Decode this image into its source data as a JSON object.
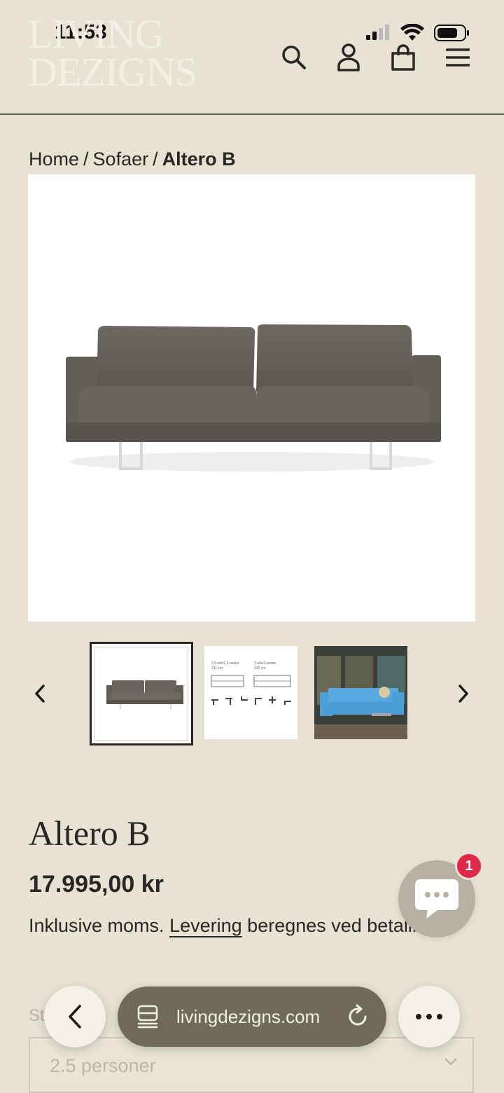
{
  "status_bar": {
    "time": "11:53"
  },
  "header": {
    "logo_line1": "LIVING",
    "logo_line2": "DEZIGNS",
    "icons": [
      "search-icon",
      "account-icon",
      "cart-icon",
      "menu-icon"
    ]
  },
  "breadcrumb": {
    "home": "Home",
    "sep": "/",
    "category": "Sofaer",
    "current": "Altero B"
  },
  "product": {
    "title": "Altero B",
    "price": "17.995,00 kr",
    "tax_prefix": "Inklusive moms.",
    "tax_link": "Levering",
    "tax_suffix": "beregnes ved betaling."
  },
  "thumbnails": {
    "spec_label_1": "2,5-sits/2,5-seater",
    "spec_size_1": "211 cm",
    "spec_label_2": "3-sits/3-seater",
    "spec_size_2": "242 cm"
  },
  "chat": {
    "badge": "1"
  },
  "size": {
    "label": "Størrelse",
    "value": "2.5 personer"
  },
  "browser": {
    "url": "livingdezigns.com"
  },
  "colors": {
    "background": "#e8e2d5",
    "text": "#2b2623",
    "badge": "#e0284a",
    "url_bar": "#6f6a5a",
    "chat_button": "#b8b0a3"
  }
}
